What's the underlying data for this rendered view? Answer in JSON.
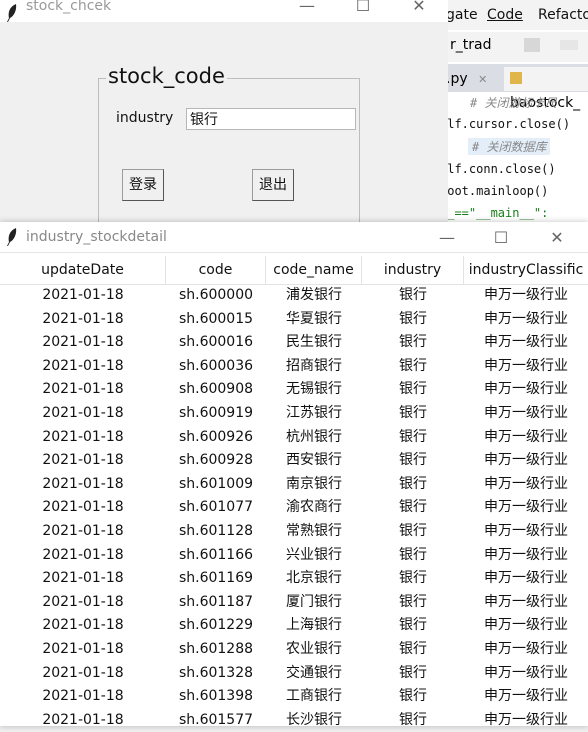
{
  "ide": {
    "menu": [
      "gate",
      "Code",
      "Refacto"
    ],
    "toolbar_text": "r_trad",
    "tabs": [
      ".py",
      "baostock_"
    ],
    "code_lines": [
      "# 关闭游标卡尺",
      "elf.cursor.close()",
      "# 关闭数据库",
      "elf.conn.close()",
      "root.mainloop()",
      "__==\"__main__\":"
    ]
  },
  "stock_chcek": {
    "title": "stock_chcek",
    "group_label": "stock_code",
    "industry_label": "industry",
    "industry_value": "银行",
    "login_button": "登录",
    "exit_button": "退出"
  },
  "stockdetail": {
    "title": "industry_stockdetail",
    "columns": [
      "updateDate",
      "code",
      "code_name",
      "industry",
      "industryClassific"
    ],
    "rows": [
      [
        "2021-01-18",
        "sh.600000",
        "浦发银行",
        "银行",
        "申万一级行业"
      ],
      [
        "2021-01-18",
        "sh.600015",
        "华夏银行",
        "银行",
        "申万一级行业"
      ],
      [
        "2021-01-18",
        "sh.600016",
        "民生银行",
        "银行",
        "申万一级行业"
      ],
      [
        "2021-01-18",
        "sh.600036",
        "招商银行",
        "银行",
        "申万一级行业"
      ],
      [
        "2021-01-18",
        "sh.600908",
        "无锡银行",
        "银行",
        "申万一级行业"
      ],
      [
        "2021-01-18",
        "sh.600919",
        "江苏银行",
        "银行",
        "申万一级行业"
      ],
      [
        "2021-01-18",
        "sh.600926",
        "杭州银行",
        "银行",
        "申万一级行业"
      ],
      [
        "2021-01-18",
        "sh.600928",
        "西安银行",
        "银行",
        "申万一级行业"
      ],
      [
        "2021-01-18",
        "sh.601009",
        "南京银行",
        "银行",
        "申万一级行业"
      ],
      [
        "2021-01-18",
        "sh.601077",
        "渝农商行",
        "银行",
        "申万一级行业"
      ],
      [
        "2021-01-18",
        "sh.601128",
        "常熟银行",
        "银行",
        "申万一级行业"
      ],
      [
        "2021-01-18",
        "sh.601166",
        "兴业银行",
        "银行",
        "申万一级行业"
      ],
      [
        "2021-01-18",
        "sh.601169",
        "北京银行",
        "银行",
        "申万一级行业"
      ],
      [
        "2021-01-18",
        "sh.601187",
        "厦门银行",
        "银行",
        "申万一级行业"
      ],
      [
        "2021-01-18",
        "sh.601229",
        "上海银行",
        "银行",
        "申万一级行业"
      ],
      [
        "2021-01-18",
        "sh.601288",
        "农业银行",
        "银行",
        "申万一级行业"
      ],
      [
        "2021-01-18",
        "sh.601328",
        "交通银行",
        "银行",
        "申万一级行业"
      ],
      [
        "2021-01-18",
        "sh.601398",
        "工商银行",
        "银行",
        "申万一级行业"
      ],
      [
        "2021-01-18",
        "sh.601577",
        "长沙银行",
        "银行",
        "申万一级行业"
      ]
    ]
  },
  "window_controls": {
    "minimize": "—",
    "maximize": "☐",
    "close": "✕"
  }
}
